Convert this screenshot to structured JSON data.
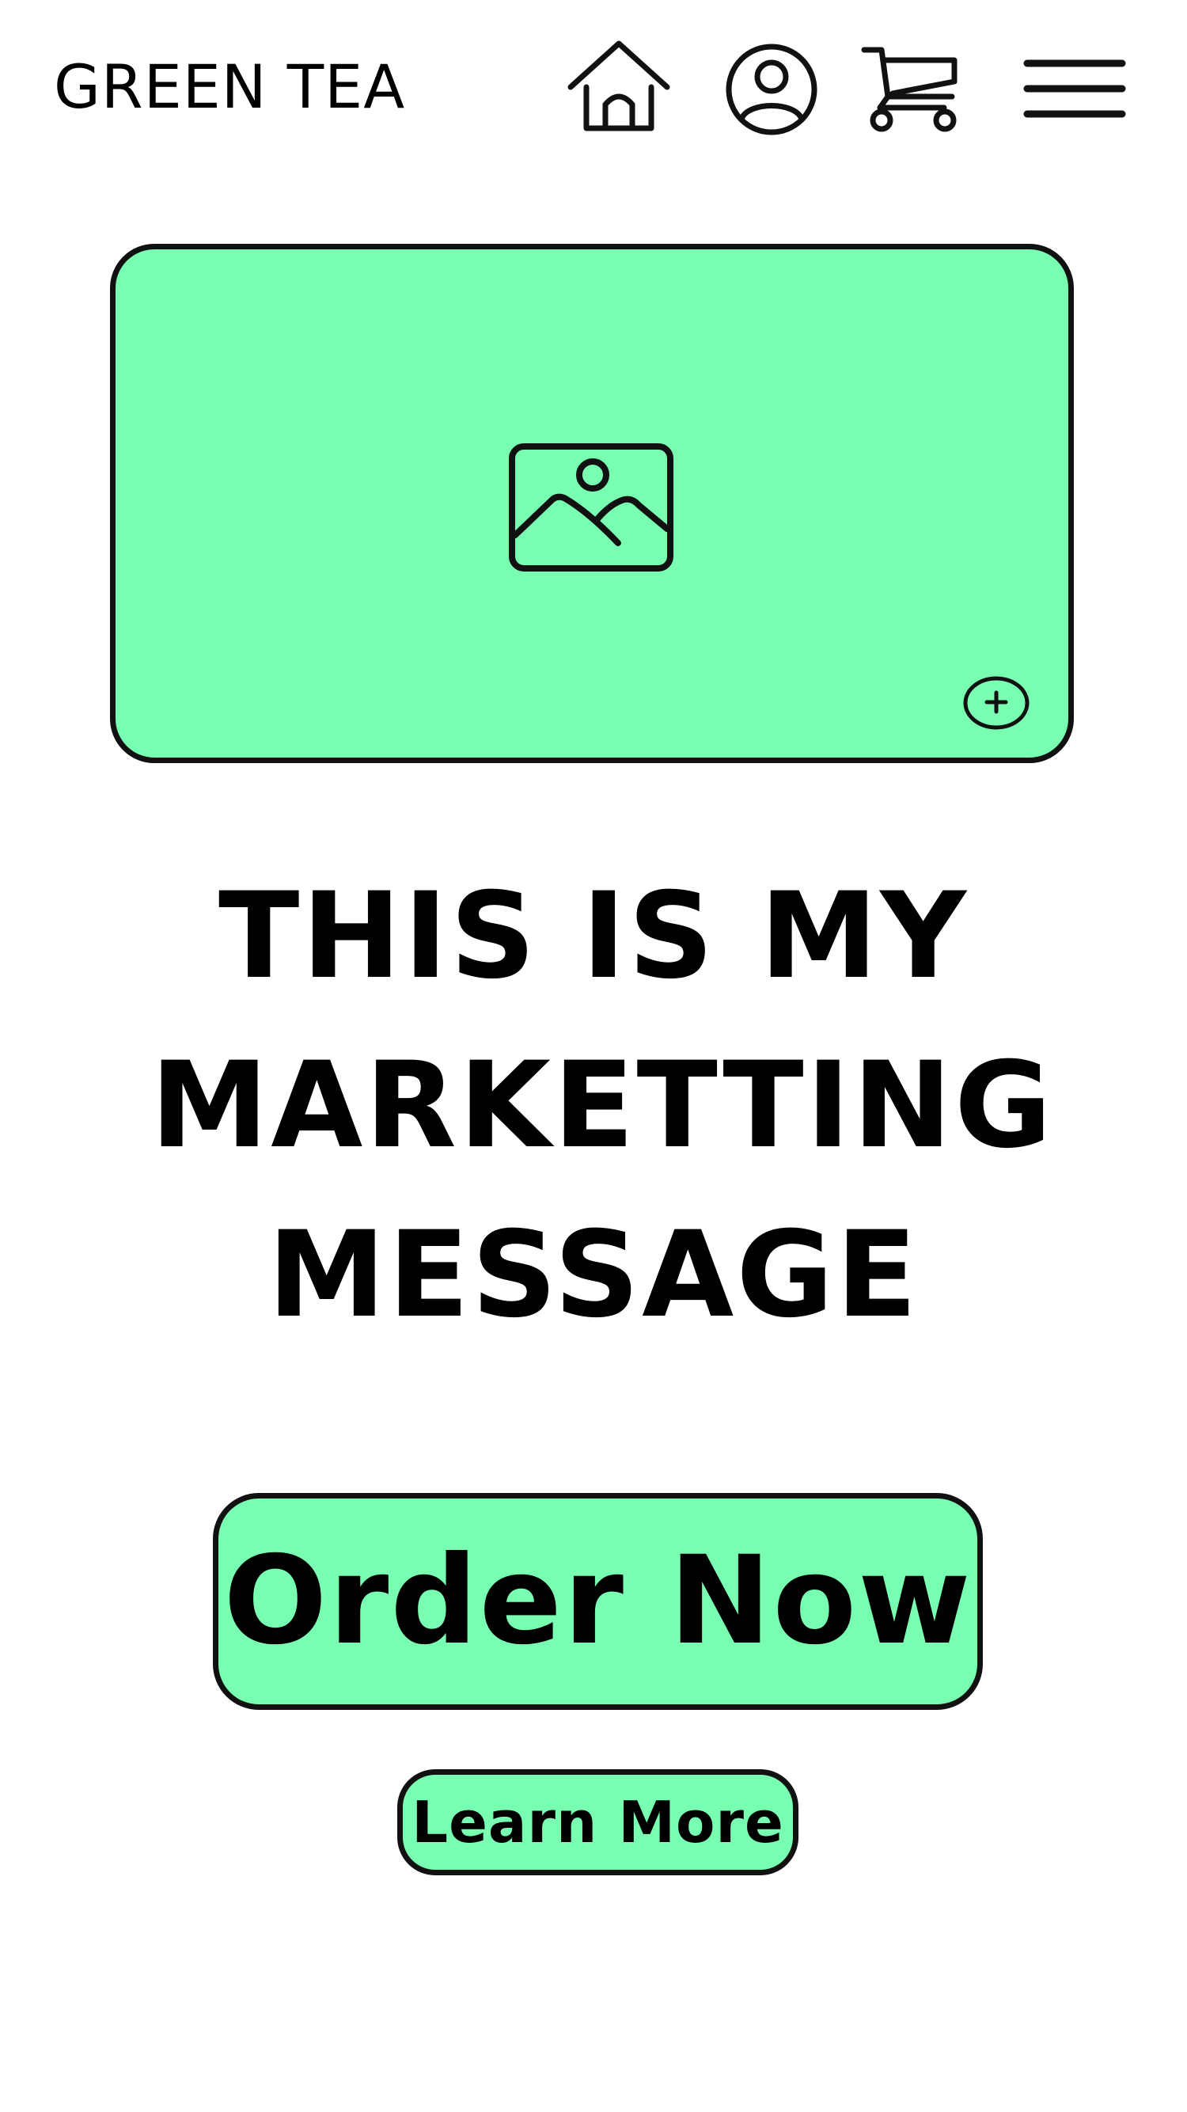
{
  "header": {
    "brand": "GREEN TEA",
    "icons": {
      "home": "home-icon",
      "user": "user-profile-icon",
      "cart": "shopping-cart-icon",
      "menu": "hamburger-menu-icon"
    }
  },
  "hero": {
    "image_icon": "image-placeholder-icon",
    "zoom_icon": "plus-circle-icon",
    "headline_lines": [
      "THIS IS MY",
      "MARKETTING",
      "MESSAGE"
    ]
  },
  "actions": {
    "primary_label": "Order Now",
    "secondary_label": "Learn More"
  },
  "colors": {
    "accent": "#78ffb2",
    "outline": "#111111",
    "text": "#000000",
    "background": "#ffffff"
  }
}
